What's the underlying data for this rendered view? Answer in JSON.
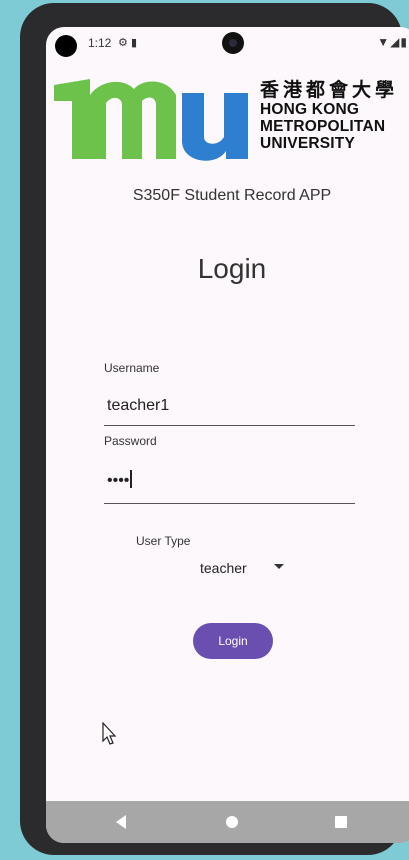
{
  "status_bar": {
    "time": "1:12",
    "left_icons": [
      "settings-icon",
      "sim-card-icon"
    ],
    "right_icons": [
      "wifi-icon",
      "signal-icon",
      "battery-icon"
    ]
  },
  "logo": {
    "chinese_name": "香港都會大學",
    "english_line1": "HONG KONG",
    "english_line2": "METROPOLITAN",
    "english_line3": "UNIVERSITY",
    "green": "#6cc24a",
    "blue": "#2f7fd0"
  },
  "app_subtitle": "S350F Student Record APP",
  "login_title": "Login",
  "username": {
    "label": "Username",
    "value": "teacher1"
  },
  "password": {
    "label": "Password",
    "value": "••••"
  },
  "user_type": {
    "label": "User Type",
    "selected": "teacher"
  },
  "login_button": {
    "label": "Login",
    "color": "#6a4fb0"
  },
  "nav_bar": {
    "buttons": [
      "back-icon",
      "home-icon",
      "recents-icon"
    ]
  }
}
